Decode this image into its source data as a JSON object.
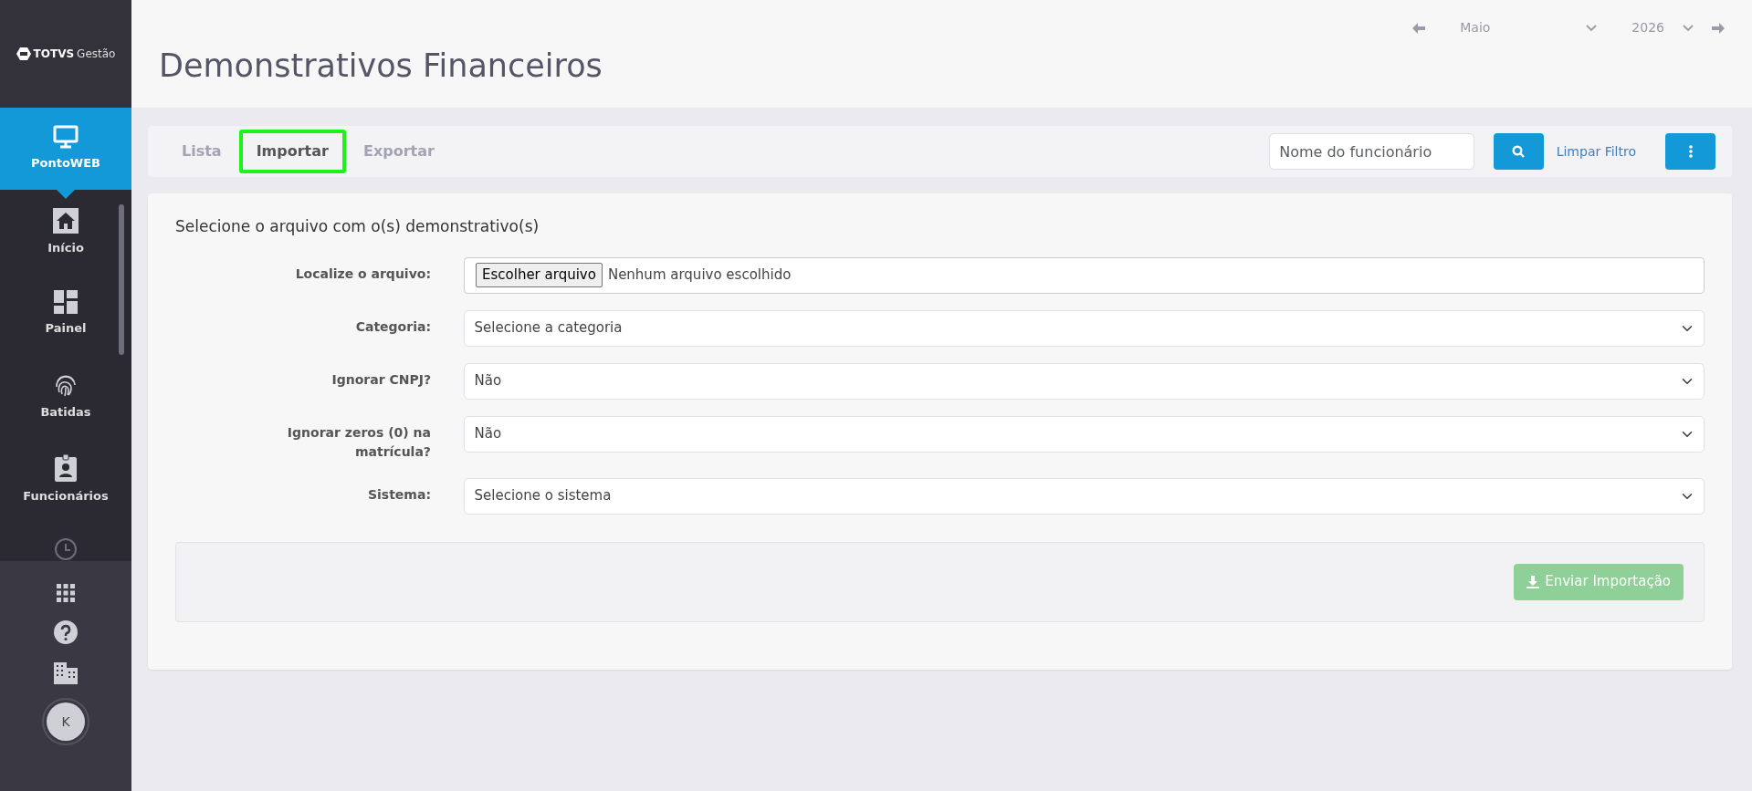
{
  "sidebar": {
    "logo": {
      "brand": "TOTVS",
      "product": "Gestão"
    },
    "module": {
      "label": "PontoWEB",
      "selected": true
    },
    "items": [
      {
        "label": "Início"
      },
      {
        "label": "Painel"
      },
      {
        "label": "Batidas"
      },
      {
        "label": "Funcionários"
      }
    ],
    "avatar": "K"
  },
  "header": {
    "title": "Demonstrativos Financeiros",
    "period": {
      "month": "Maio",
      "year": "2026"
    }
  },
  "tabs": [
    {
      "label": "Lista",
      "selected": false
    },
    {
      "label": "Importar",
      "selected": true
    },
    {
      "label": "Exportar",
      "selected": false
    }
  ],
  "filter": {
    "placeholder": "Nome do funcionário",
    "clear_link": "Limpar Filtro"
  },
  "form": {
    "heading": "Selecione o arquivo com o(s) demonstrativo(s)",
    "fields": [
      {
        "kind": "file",
        "label": "Localize o arquivo:",
        "button": "Escolher arquivo",
        "value": "Nenhum arquivo escolhido"
      },
      {
        "kind": "select",
        "label": "Categoria:",
        "value": "Selecione a categoria"
      },
      {
        "kind": "select",
        "label": "Ignorar CNPJ?",
        "value": "Não"
      },
      {
        "kind": "select",
        "label": "Ignorar zeros (0) na matrícula?",
        "value": "Não"
      },
      {
        "kind": "select",
        "label": "Sistema:",
        "value": "Selecione o sistema"
      }
    ],
    "submit": {
      "label": "Enviar Importação",
      "disabled": true
    }
  }
}
